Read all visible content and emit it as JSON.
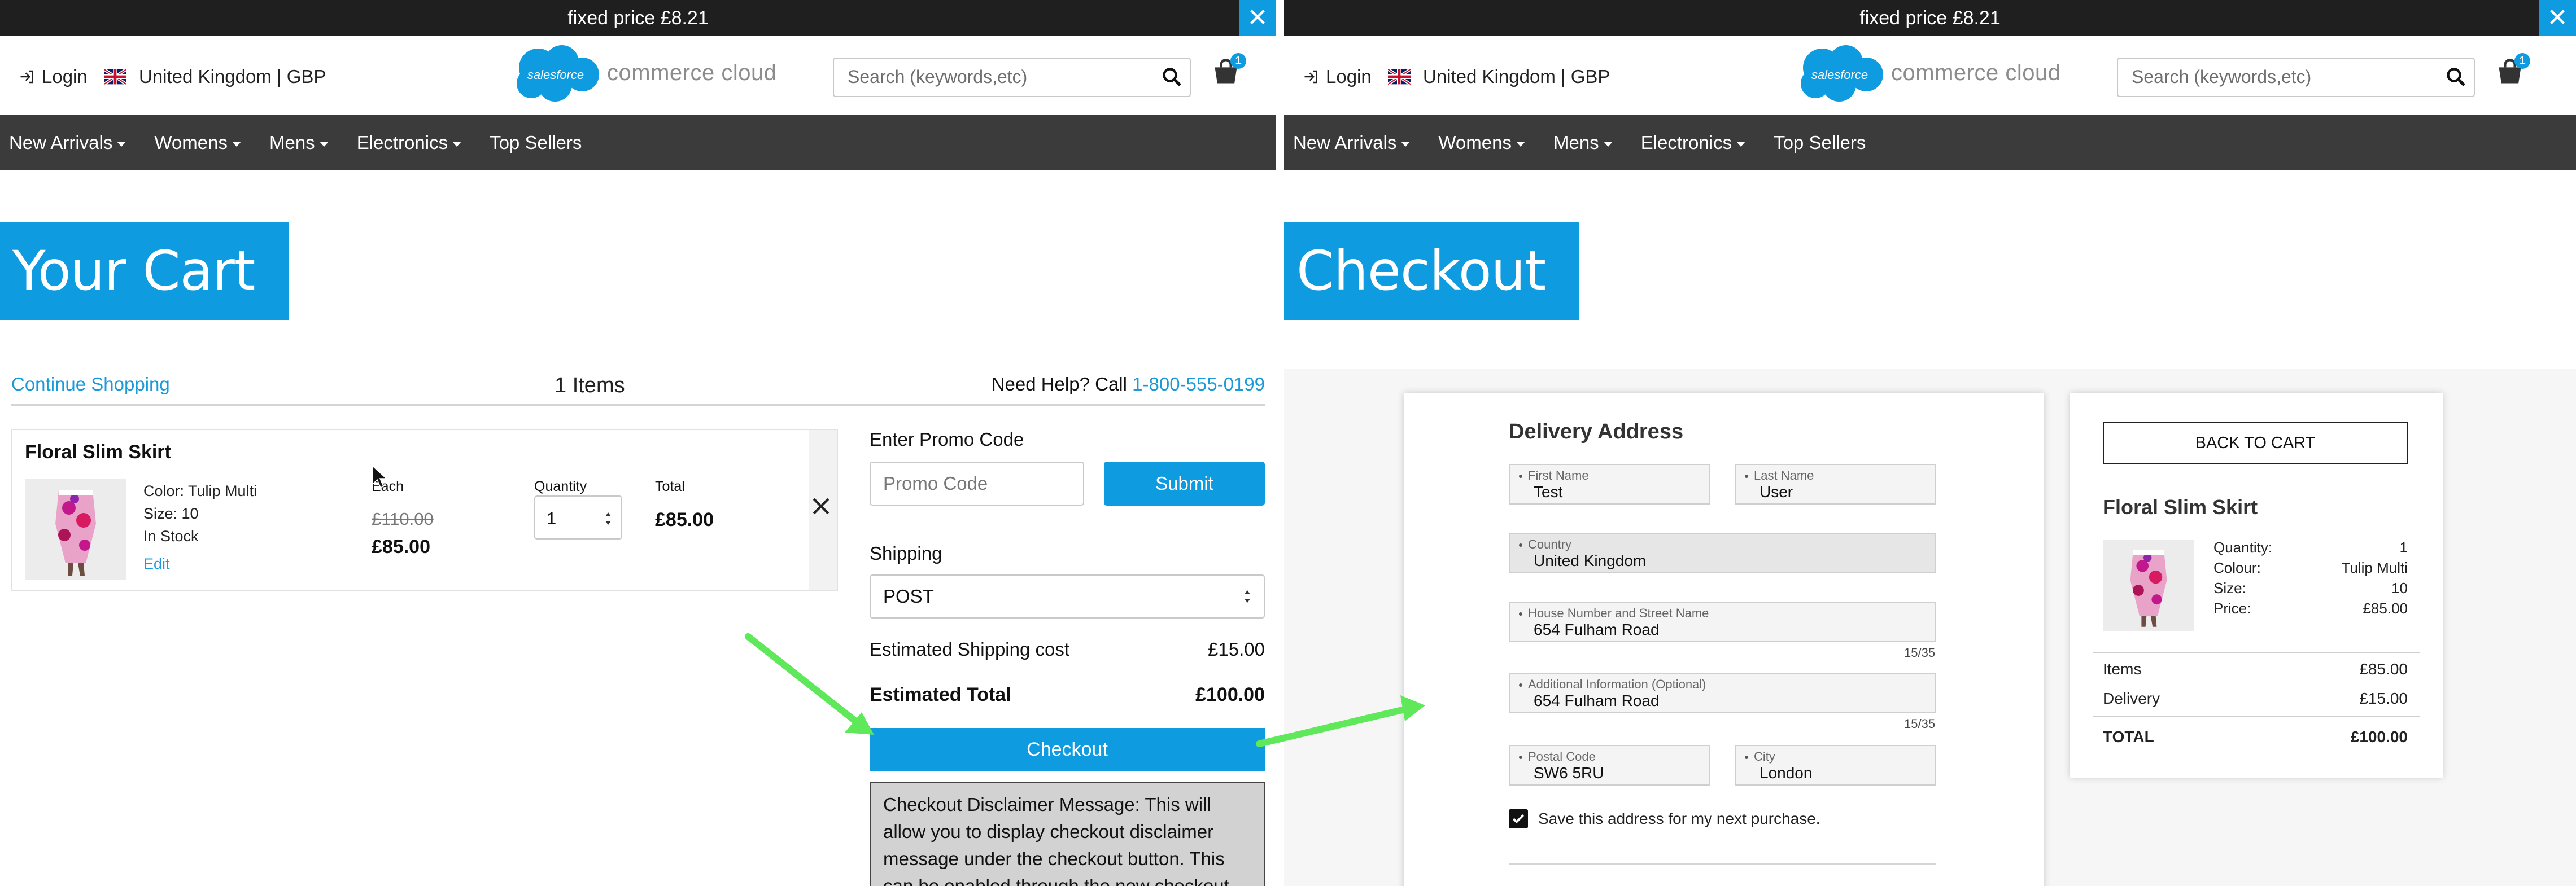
{
  "colors": {
    "accent": "#0f9be0",
    "banner": "#1f1f1f",
    "nav": "#3b3b3b",
    "arrow": "#5ee85a"
  },
  "cart_screen": {
    "banner": {
      "text": "fixed price £8.21",
      "close_icon": "close-icon"
    },
    "header": {
      "login": "Login",
      "locale": "United Kingdom | GBP",
      "logo_badge": "salesforce",
      "logo_text": "commerce cloud",
      "search_placeholder": "Search (keywords,etc)",
      "cart_count": "1"
    },
    "nav": [
      "New Arrivals",
      "Womens",
      "Mens",
      "Electronics",
      "Top Sellers"
    ],
    "title": "Your Cart",
    "continue_shopping": "Continue Shopping",
    "items_count": "1 Items",
    "help_text": "Need Help? Call",
    "help_phone": "1-800-555-0199",
    "product": {
      "name": "Floral Slim Skirt",
      "color": "Color: Tulip Multi",
      "size": "Size: 10",
      "stock": "In Stock",
      "edit": "Edit",
      "each_label": "Each",
      "old_price": "£110.00",
      "price": "£85.00",
      "quantity_label": "Quantity",
      "quantity": "1",
      "total_label": "Total",
      "total": "£85.00"
    },
    "promo": {
      "label": "Enter Promo Code",
      "placeholder": "Promo Code",
      "submit": "Submit"
    },
    "shipping": {
      "label": "Shipping",
      "method": "POST"
    },
    "estimated_shipping_label": "Estimated Shipping cost",
    "estimated_shipping_value": "£15.00",
    "estimated_total_label": "Estimated Total",
    "estimated_total_value": "£100.00",
    "checkout_button": "Checkout",
    "disclaimer": "Checkout Disclaimer Message: This will allow you to display checkout disclaimer message under the checkout button. This can be enabled through the new checkout"
  },
  "checkout_screen": {
    "banner": {
      "text": "fixed price £8.21"
    },
    "header": {
      "login": "Login",
      "locale": "United Kingdom | GBP",
      "logo_badge": "salesforce",
      "logo_text": "commerce cloud",
      "search_placeholder": "Search (keywords,etc)",
      "cart_count": "1"
    },
    "nav": [
      "New Arrivals",
      "Womens",
      "Mens",
      "Electronics",
      "Top Sellers"
    ],
    "title": "Checkout",
    "form": {
      "title": "Delivery Address",
      "first_name_label": "First Name",
      "first_name": "Test",
      "last_name_label": "Last Name",
      "last_name": "User",
      "country_label": "Country",
      "country": "United Kingdom",
      "address1_label": "House Number and Street Name",
      "address1": "654 Fulham Road",
      "address1_counter": "15/35",
      "address2_label": "Additional Information (Optional)",
      "address2": "654 Fulham Road",
      "address2_counter": "15/35",
      "postal_label": "Postal Code",
      "postal": "SW6 5RU",
      "city_label": "City",
      "city": "London",
      "save_address": "Save this address for my next purchase.",
      "save_checked": true
    },
    "summary": {
      "back_button": "BACK TO CART",
      "product_name": "Floral Slim Skirt",
      "rows": [
        {
          "label": "Quantity:",
          "value": "1"
        },
        {
          "label": "Colour:",
          "value": "Tulip Multi"
        },
        {
          "label": "Size:",
          "value": "10"
        },
        {
          "label": "Price:",
          "value": "£85.00"
        }
      ],
      "items_label": "Items",
      "items_value": "£85.00",
      "delivery_label": "Delivery",
      "delivery_value": "£15.00",
      "total_label": "TOTAL",
      "total_value": "£100.00"
    }
  }
}
